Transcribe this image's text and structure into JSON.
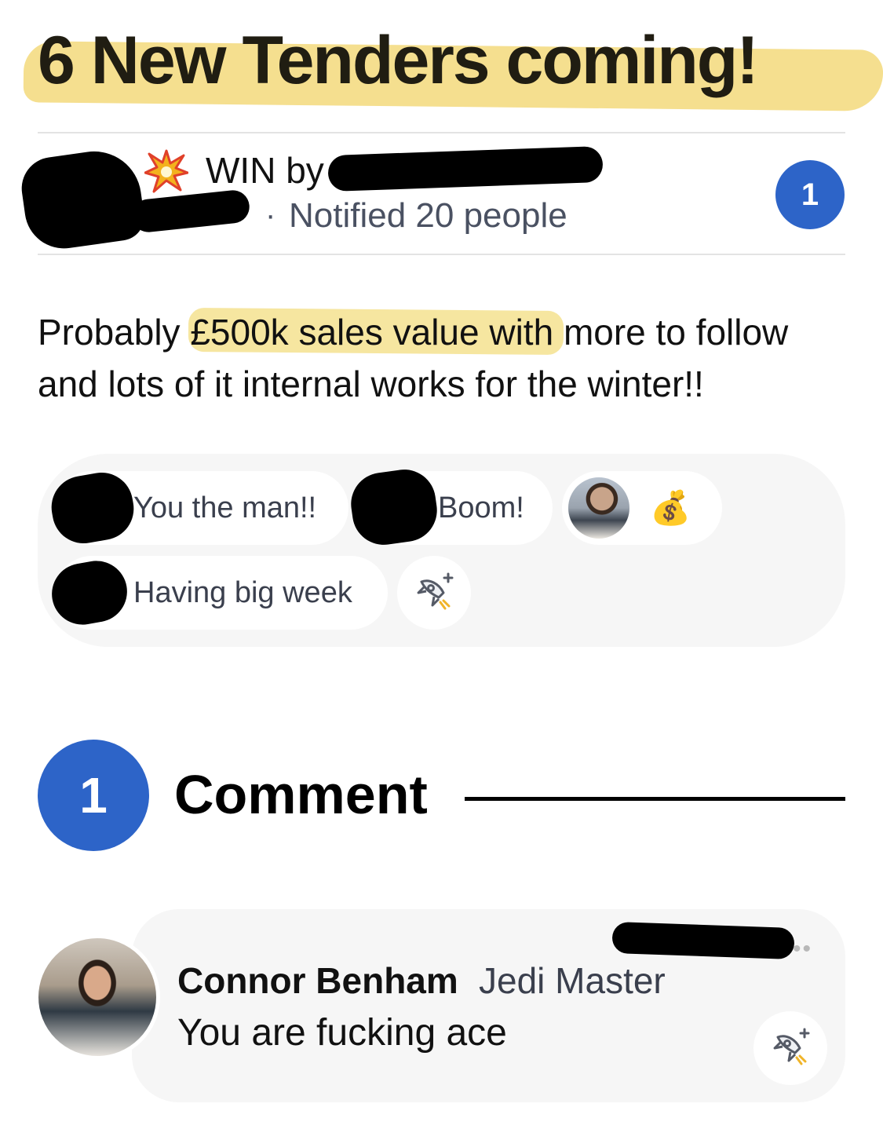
{
  "post": {
    "title": "6 New Tenders coming!",
    "tag": "WIN by",
    "notified": "Notified 20 people",
    "comment_count_badge": "1",
    "body": "Probably £500k sales value with more to follow and lots of it internal works for the winter!!"
  },
  "reactions": {
    "items": [
      {
        "text": "You the man!!"
      },
      {
        "text": "Boom!"
      },
      {
        "emoji": "💰"
      },
      {
        "text": "Having big week"
      }
    ],
    "add_icon": "rocket-add-icon"
  },
  "comments": {
    "count": "1",
    "heading": "Comment",
    "items": [
      {
        "author": "Connor Benham",
        "role": "Jedi Master",
        "text": "You are fucking ace",
        "action_icon": "rocket-add-icon"
      }
    ]
  },
  "colors": {
    "accent_blue": "#2d64c8",
    "highlight_yellow": "#f4dc83",
    "reaction_bg": "#f6f6f6"
  }
}
